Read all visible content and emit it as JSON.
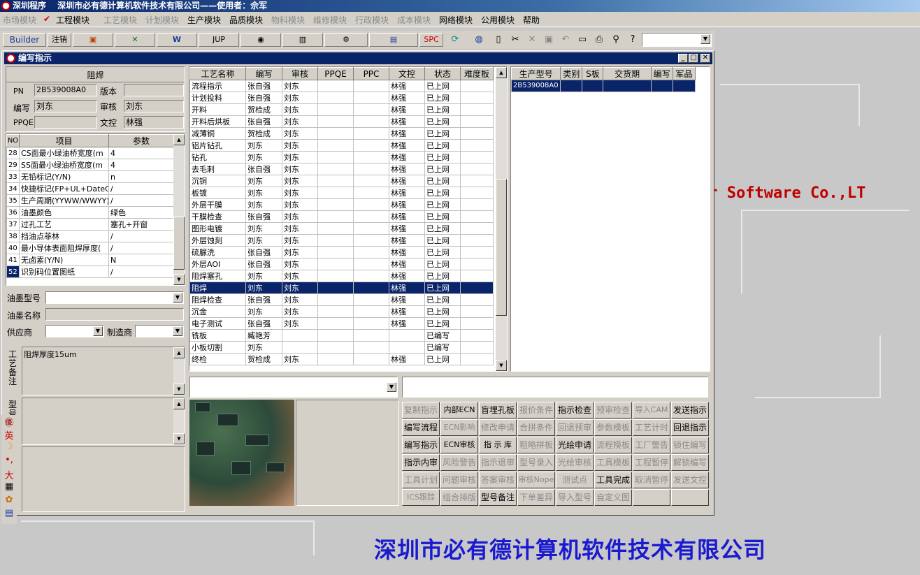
{
  "app": {
    "title": "深圳程序　 深圳市必有德计算机软件技术有限公司——使用者：佘军"
  },
  "menu": [
    {
      "label": "市场模块",
      "enabled": false
    },
    {
      "label": "工程模块",
      "enabled": true,
      "checked": true
    },
    {
      "label": "工艺模块",
      "enabled": false
    },
    {
      "label": "计划模块",
      "enabled": false
    },
    {
      "label": "生产模块",
      "enabled": true
    },
    {
      "label": "品质模块",
      "enabled": true
    },
    {
      "label": "物料模块",
      "enabled": false
    },
    {
      "label": "维修模块",
      "enabled": false
    },
    {
      "label": "行政模块",
      "enabled": false
    },
    {
      "label": "成本模块",
      "enabled": false
    },
    {
      "label": "网络模块",
      "enabled": true
    },
    {
      "label": "公用模块",
      "enabled": true
    },
    {
      "label": "帮助",
      "enabled": true
    }
  ],
  "toolbar": {
    "builder": "Builder",
    "logout": "注销",
    "jup": "JUP",
    "spc": "SPC"
  },
  "window": {
    "title": "编写指示"
  },
  "left": {
    "process_name": "阻焊",
    "pn_label": "PN",
    "pn": "2B539008A0",
    "version_label": "版本",
    "version": "",
    "writer_label": "编写",
    "writer": "刘东",
    "reviewer_label": "审核",
    "reviewer": "刘东",
    "ppqe_label": "PPQE",
    "ppqe": "",
    "wenkong_label": "文控",
    "wenkong": "林强",
    "param_headers": [
      "NO",
      "项目",
      "参数"
    ],
    "params": [
      [
        "28",
        "CS面最小绿油桥宽度(m",
        "4"
      ],
      [
        "29",
        "SS面最小绿油桥宽度(m",
        "4"
      ],
      [
        "33",
        "无铅标记(Y/N)",
        "n"
      ],
      [
        "34",
        "快捷标记(FP+UL+DateCo",
        "/"
      ],
      [
        "35",
        "生产周期(YYWW/WWYY)",
        "/"
      ],
      [
        "36",
        "油墨颜色",
        "绿色"
      ],
      [
        "37",
        "过孔工艺",
        "塞孔+开窗"
      ],
      [
        "38",
        "挡油点菲林",
        "/"
      ],
      [
        "40",
        "最小导体表面阻焊厚度(",
        "/"
      ],
      [
        "41",
        "无卤素(Y/N)",
        "N"
      ],
      [
        "52",
        "识别码位置图纸",
        "/"
      ]
    ],
    "ink_model_label": "油墨型号",
    "ink_name_label": "油墨名称",
    "supplier_label": "供应商",
    "maker_label": "制造商",
    "remark_label": "工艺备注",
    "remark": "阻焊厚度15um",
    "type_label": "型号"
  },
  "grid": {
    "headers": [
      "工艺名称",
      "编写",
      "审核",
      "PPQE",
      "PPC",
      "文控",
      "状态",
      "难度板"
    ],
    "rows": [
      [
        "流程指示",
        "张自强",
        "刘东",
        "",
        "",
        "林强",
        "已上网",
        ""
      ],
      [
        "计划投料",
        "张自强",
        "刘东",
        "",
        "",
        "林强",
        "已上网",
        ""
      ],
      [
        "开料",
        "贺检成",
        "刘东",
        "",
        "",
        "林强",
        "已上网",
        ""
      ],
      [
        "开料后烘板",
        "张自强",
        "刘东",
        "",
        "",
        "林强",
        "已上网",
        ""
      ],
      [
        "减薄铜",
        "贺检成",
        "刘东",
        "",
        "",
        "林强",
        "已上网",
        ""
      ],
      [
        "铝片钻孔",
        "刘东",
        "刘东",
        "",
        "",
        "林强",
        "已上网",
        ""
      ],
      [
        "钻孔",
        "刘东",
        "刘东",
        "",
        "",
        "林强",
        "已上网",
        ""
      ],
      [
        "去毛刺",
        "张自强",
        "刘东",
        "",
        "",
        "林强",
        "已上网",
        ""
      ],
      [
        "沉铜",
        "刘东",
        "刘东",
        "",
        "",
        "林强",
        "已上网",
        ""
      ],
      [
        "板镀",
        "刘东",
        "刘东",
        "",
        "",
        "林强",
        "已上网",
        ""
      ],
      [
        "外层干膜",
        "刘东",
        "刘东",
        "",
        "",
        "林强",
        "已上网",
        ""
      ],
      [
        "干膜检查",
        "张自强",
        "刘东",
        "",
        "",
        "林强",
        "已上网",
        ""
      ],
      [
        "图形电镀",
        "刘东",
        "刘东",
        "",
        "",
        "林强",
        "已上网",
        ""
      ],
      [
        "外层蚀刻",
        "刘东",
        "刘东",
        "",
        "",
        "林强",
        "已上网",
        ""
      ],
      [
        "硫脲洗",
        "张自强",
        "刘东",
        "",
        "",
        "林强",
        "已上网",
        ""
      ],
      [
        "外层AOI",
        "张自强",
        "刘东",
        "",
        "",
        "林强",
        "已上网",
        ""
      ],
      [
        "阻焊塞孔",
        "刘东",
        "刘东",
        "",
        "",
        "林强",
        "已上网",
        ""
      ],
      [
        "阻焊",
        "刘东",
        "刘东",
        "",
        "",
        "林强",
        "已上网",
        ""
      ],
      [
        "阻焊检查",
        "张自强",
        "刘东",
        "",
        "",
        "林强",
        "已上网",
        ""
      ],
      [
        "沉金",
        "刘东",
        "刘东",
        "",
        "",
        "林强",
        "已上网",
        ""
      ],
      [
        "电子测试",
        "张自强",
        "刘东",
        "",
        "",
        "林强",
        "已上网",
        ""
      ],
      [
        "铣板",
        "臧艳芳",
        "",
        "",
        "",
        "",
        "已编写",
        ""
      ],
      [
        "小板切割",
        "刘东",
        "",
        "",
        "",
        "",
        "已编写",
        ""
      ],
      [
        "终检",
        "贺检成",
        "刘东",
        "",
        "",
        "林强",
        "已上网",
        ""
      ]
    ]
  },
  "right": {
    "headers": [
      "生产型号",
      "类别",
      "S板",
      "交货期",
      "编写",
      "军品"
    ],
    "rows": [
      [
        "2B539008A0",
        "",
        "",
        "",
        "",
        ""
      ]
    ]
  },
  "buttons": [
    [
      "复制指示",
      "内部ECN",
      "盲埋孔板",
      "报价条件",
      "指示检查",
      "预审检查",
      "导入CAM",
      "发送指示"
    ],
    [
      "编写流程",
      "ECN影响",
      "修改申请",
      "合拼条件",
      "回退预审",
      "参数模板",
      "工艺计时",
      "回退指示"
    ],
    [
      "编写指示",
      "ECN审核",
      "指 示 库",
      "粗略拼板",
      "光绘申请",
      "流程模板",
      "工厂警告",
      "锁住编写"
    ],
    [
      "指示内审",
      "风险警告",
      "指示退审",
      "型号录入",
      "光绘审核",
      "工具模板",
      "工程暂停",
      "解锁编写"
    ],
    [
      "工具计划",
      "问题审核",
      "答案审核",
      "审核Nope",
      "测试点",
      "工具完成",
      "取消暂停",
      "发送文控"
    ],
    [
      "ICS跟踪",
      "组合排版",
      "型号备注",
      "下单差异",
      "导入型号",
      "自定义图",
      "",
      ""
    ]
  ],
  "buttons_enabled": [
    [
      0,
      1,
      1,
      0,
      1,
      0,
      0,
      1
    ],
    [
      1,
      0,
      0,
      0,
      0,
      0,
      0,
      1
    ],
    [
      1,
      1,
      1,
      0,
      1,
      0,
      0,
      0
    ],
    [
      1,
      0,
      0,
      0,
      0,
      0,
      0,
      0
    ],
    [
      0,
      0,
      0,
      0,
      0,
      1,
      0,
      0
    ],
    [
      0,
      0,
      1,
      0,
      0,
      0,
      0,
      0
    ]
  ],
  "background": {
    "slogan": "er Software Co.,LT",
    "brand": "深圳市必有德计算机软件技术有限公司"
  },
  "ime": [
    "英",
    "大"
  ]
}
